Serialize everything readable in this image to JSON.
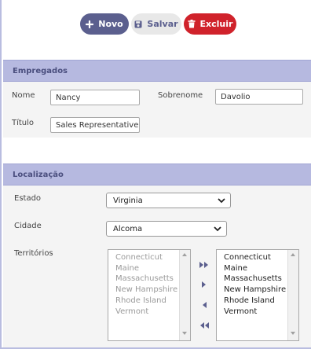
{
  "toolbar": {
    "novo": "Novo",
    "salvar": "Salvar",
    "excluir": "Excluir"
  },
  "empregados": {
    "title": "Empregados",
    "nome_label": "Nome",
    "nome_value": "Nancy",
    "sobrenome_label": "Sobrenome",
    "sobrenome_value": "Davolio",
    "titulo_label": "Título",
    "titulo_value": "Sales Representative"
  },
  "localizacao": {
    "title": "Localização",
    "estado_label": "Estado",
    "estado_value": "Virginia",
    "cidade_label": "Cidade",
    "cidade_value": "Alcoma",
    "territorios_label": "Territórios",
    "available": [
      "Connecticut",
      "Maine",
      "Massachusetts",
      "New Hampshire",
      "Rhode Island",
      "Vermont"
    ],
    "selected": [
      "Connecticut",
      "Maine",
      "Massachusetts",
      "New Hampshire",
      "Rhode Island",
      "Vermont"
    ]
  },
  "colors": {
    "primary": "#5b5f8e",
    "danger": "#d0222b",
    "panel_header": "#b6b9e0"
  },
  "icons": [
    "plus-icon",
    "save-icon",
    "trash-icon",
    "chevron-down-icon",
    "move-all-right-icon",
    "move-right-icon",
    "move-left-icon",
    "move-all-left-icon"
  ]
}
